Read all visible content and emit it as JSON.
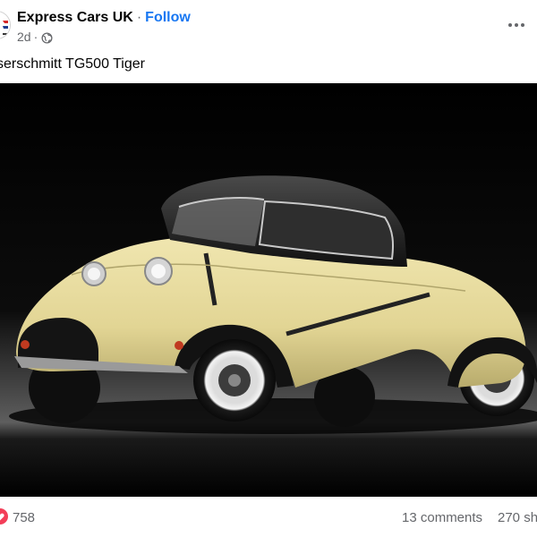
{
  "post": {
    "page_name": "Express Cars UK",
    "separator": "·",
    "follow_label": "Follow",
    "time_ago": "2d",
    "meta_separator": "·",
    "audience_icon": "globe-icon",
    "more_icon": "more-horizontal-icon",
    "caption": "serschmitt TG500 Tiger",
    "photo_subject": "yellow bubble car with black roof"
  },
  "footer": {
    "reaction_icon": "heart-icon",
    "reaction_count": "758",
    "comments": "13 comments",
    "shares": "270 sh"
  },
  "colors": {
    "link_blue": "#1877f2",
    "secondary_text": "#65676b",
    "reaction_red": "#f33e58",
    "car_yellow": "#e8dc9c"
  }
}
